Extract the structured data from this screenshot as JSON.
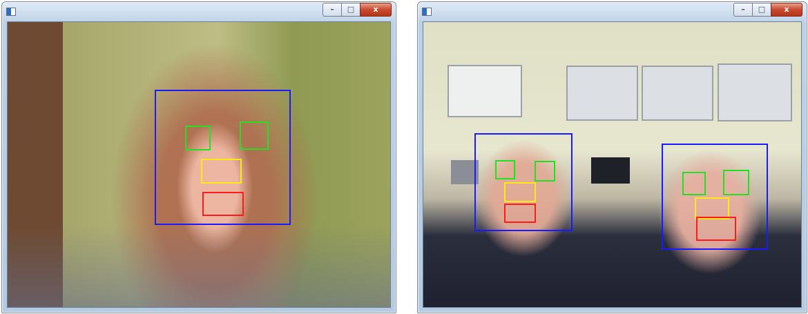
{
  "windows": [
    {
      "id": "left",
      "title": "",
      "icon": "app-window-icon",
      "buttons": {
        "minimize": "–",
        "maximize": "□",
        "close": "x"
      }
    },
    {
      "id": "right",
      "title": "",
      "icon": "app-window-icon",
      "buttons": {
        "minimize": "–",
        "maximize": "□",
        "close": "x"
      }
    }
  ],
  "detection_colors": {
    "face": "#1a1aff",
    "eye": "#22e022",
    "nose": "#ffe81a",
    "mouth": "#ff1a1a"
  }
}
